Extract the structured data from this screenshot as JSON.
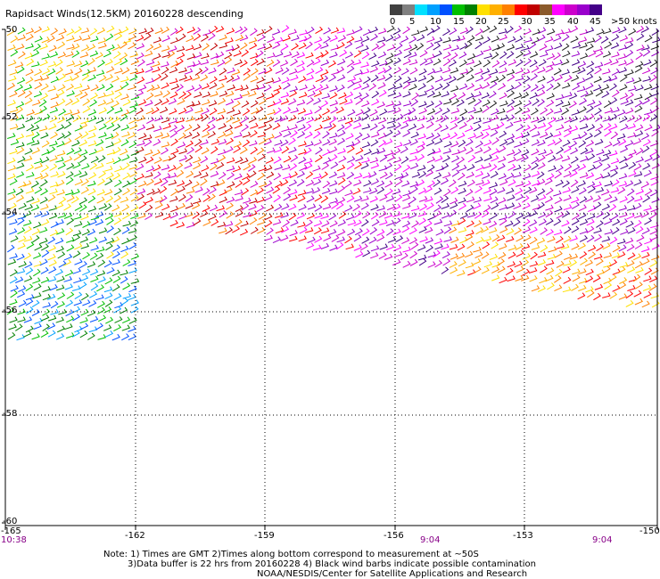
{
  "title": "Rapidsact Winds(12.5KM) 20160228 descending",
  "legend": {
    "colors": [
      "#404040",
      "#808080",
      "#00e0ff",
      "#00a0ff",
      "#0050ff",
      "#00c000",
      "#008000",
      "#ffe000",
      "#ffb000",
      "#ff8000",
      "#ff0000",
      "#c00000",
      "#8b5a2b",
      "#ff00ff",
      "#cc00cc",
      "#9900cc",
      "#440088"
    ],
    "labels": [
      "0",
      "5",
      "10",
      "15",
      "20",
      "25",
      "30",
      "35",
      "40",
      "45",
      ">50 knots"
    ],
    "units": "knots"
  },
  "axes": {
    "x_ticks": [
      "-165",
      "-162",
      "-159",
      "-156",
      "-153",
      "-150"
    ],
    "y_ticks": [
      "-50",
      "-52",
      "-54",
      "-56",
      "-58",
      "-60"
    ]
  },
  "times": [
    "10:38",
    "9:04",
    "9:04"
  ],
  "note": {
    "line1": "Note: 1) Times are GMT 2)Times along bottom correspond to measurement at ~50S",
    "line2": "3)Data buffer is 22 hrs from 20160228 4) Black wind barbs indicate possible contamination",
    "line3": "NOAA/NESDIS/Center for Satellite Applications and Research"
  }
}
